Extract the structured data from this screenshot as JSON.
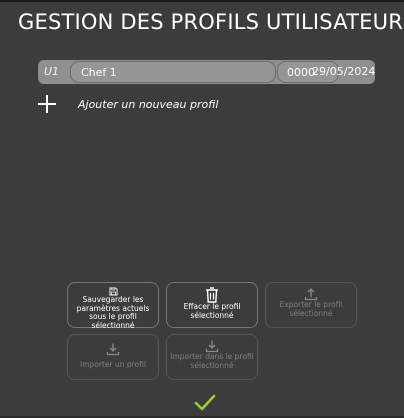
{
  "header": {
    "title": "GESTION DES PROFILS UTILISATEURS:"
  },
  "profiles": [
    {
      "code": "U1",
      "name": "Chef 1",
      "pin": "0000",
      "date": "29/05/2024"
    }
  ],
  "add_profile": {
    "label": "Ajouter un nouveau profil",
    "icon": "plus-icon"
  },
  "actions": {
    "save": {
      "label": "Sauvegarder les paramètres actuels sous le profil sélectionné",
      "icon": "floppy-icon",
      "enabled": true
    },
    "delete": {
      "label": "Effacer le profil sélectionné",
      "icon": "trash-icon",
      "enabled": true
    },
    "export": {
      "label": "Exporter le profil sélectionné",
      "icon": "upload-icon",
      "enabled": false
    },
    "import": {
      "label": "Importer un profil",
      "icon": "download-icon",
      "enabled": false
    },
    "import_into": {
      "label": "Importer dans le profil sélectionné",
      "icon": "download-icon",
      "enabled": false
    }
  },
  "confirm": {
    "icon": "checkmark-icon",
    "color": "#9acd32"
  },
  "colors": {
    "background": "#3c3c3c",
    "row": "#8f8f8f",
    "disabled_text": "#808080"
  }
}
